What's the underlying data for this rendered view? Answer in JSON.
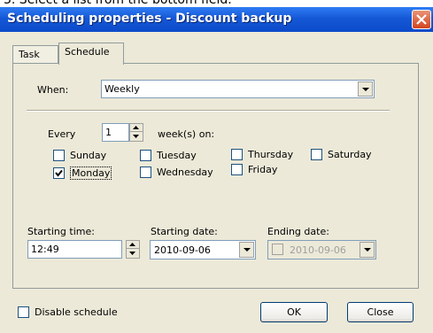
{
  "caption": "3. Select a list from the bottom field.",
  "window": {
    "title": "Scheduling properties - Discount backup"
  },
  "tabs": {
    "task": "Task",
    "schedule": "Schedule"
  },
  "schedule": {
    "when_label": "When:",
    "when_value": "Weekly",
    "every_label": "Every",
    "every_value": "1",
    "weeks_on_label": "week(s) on:",
    "days": {
      "sunday": {
        "label": "Sunday",
        "checked": false
      },
      "monday": {
        "label": "Monday",
        "checked": true
      },
      "tuesday": {
        "label": "Tuesday",
        "checked": false
      },
      "wednesday": {
        "label": "Wednesday",
        "checked": false
      },
      "thursday": {
        "label": "Thursday",
        "checked": false
      },
      "friday": {
        "label": "Friday",
        "checked": false
      },
      "saturday": {
        "label": "Saturday",
        "checked": false
      }
    },
    "starting_time_label": "Starting time:",
    "starting_time_value": "12:49",
    "starting_date_label": "Starting date:",
    "starting_date_value": "2010-09-06",
    "ending_date_label": "Ending date:",
    "ending_date_value": "2010-09-06",
    "ending_date_enabled": false
  },
  "footer": {
    "disable_schedule_label": "Disable schedule",
    "disable_schedule_checked": false,
    "ok_label": "OK",
    "close_label": "Close"
  },
  "colors": {
    "titlebar": "#0c4ac9",
    "dialog_bg": "#ece9d8",
    "close_button": "#d4441f"
  }
}
